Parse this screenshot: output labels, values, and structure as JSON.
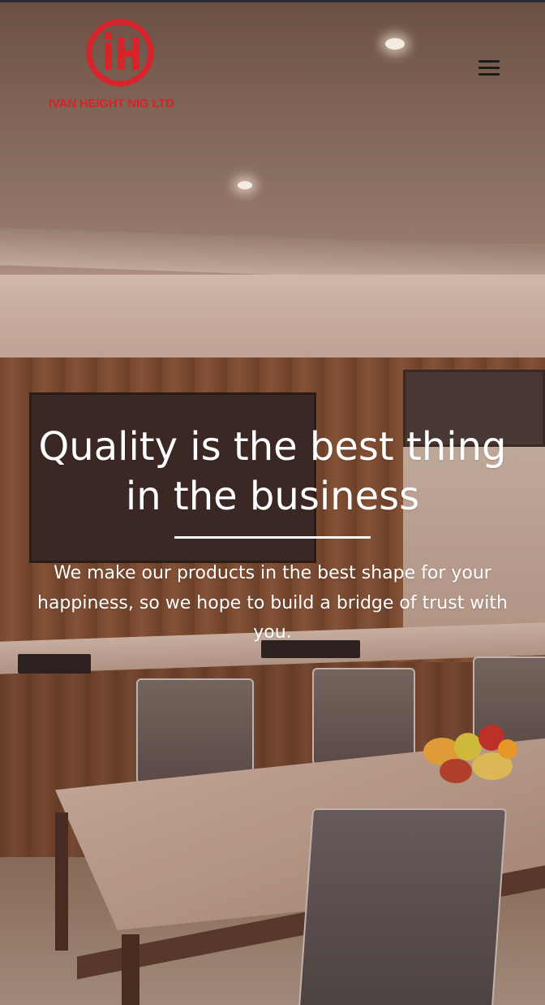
{
  "header": {
    "logo_text": "IVAN HEIGHT NIG LTD",
    "logo_icon": "ih-monogram-logo",
    "menu_icon": "hamburger-menu-icon"
  },
  "hero": {
    "headline_line1": "Quality is the best thing",
    "headline_line2": "in the business",
    "subtext": "We make our products in the best shape for your happiness, so we hope to build a bridge of trust with you.",
    "background": "dining-room-interior-photo"
  },
  "colors": {
    "brand_red": "#d8232a",
    "text_white": "#ffffff",
    "menu_icon": "#1f1b1a"
  }
}
